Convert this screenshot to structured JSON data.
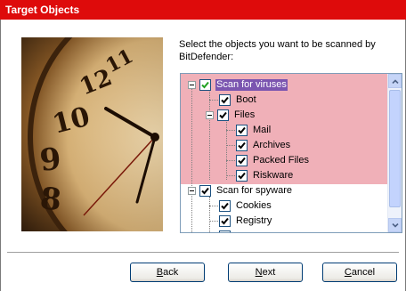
{
  "window": {
    "title": "Target Objects"
  },
  "intro_text": "Select the objects you want to be scanned by BitDefender:",
  "tree": {
    "nodes": [
      {
        "label": "Scan for viruses",
        "checked": true,
        "expanded": true
      },
      {
        "label": "Boot",
        "checked": true
      },
      {
        "label": "Files",
        "checked": true,
        "expanded": true
      },
      {
        "label": "Mail",
        "checked": true
      },
      {
        "label": "Archives",
        "checked": true
      },
      {
        "label": "Packed Files",
        "checked": true
      },
      {
        "label": "Riskware",
        "checked": true
      },
      {
        "label": "Scan for spyware",
        "checked": true,
        "expanded": true
      },
      {
        "label": "Cookies",
        "checked": true
      },
      {
        "label": "Registry",
        "checked": true
      }
    ],
    "highlight_color": "#f0b0b8",
    "selection_color": "#7b55b0"
  },
  "buttons": {
    "back": {
      "mnemonic": "B",
      "rest": "ack"
    },
    "next": {
      "mnemonic": "N",
      "rest": "ext"
    },
    "cancel": {
      "mnemonic": "C",
      "rest": "ancel"
    }
  },
  "colors": {
    "titlebar": "#de0b0b"
  }
}
